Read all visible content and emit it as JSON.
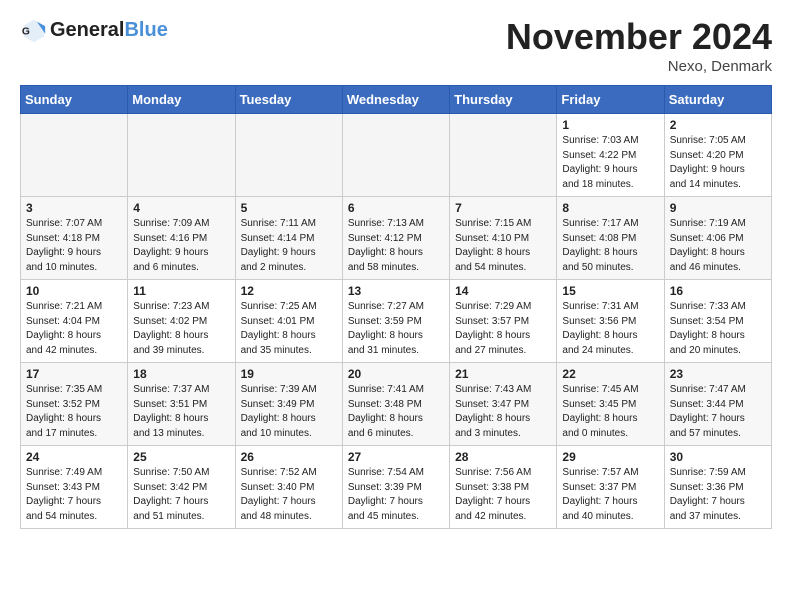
{
  "logo": {
    "line1": "General",
    "line2": "Blue"
  },
  "title": "November 2024",
  "location": "Nexo, Denmark",
  "days_of_week": [
    "Sunday",
    "Monday",
    "Tuesday",
    "Wednesday",
    "Thursday",
    "Friday",
    "Saturday"
  ],
  "weeks": [
    [
      {
        "day": "",
        "info": ""
      },
      {
        "day": "",
        "info": ""
      },
      {
        "day": "",
        "info": ""
      },
      {
        "day": "",
        "info": ""
      },
      {
        "day": "",
        "info": ""
      },
      {
        "day": "1",
        "info": "Sunrise: 7:03 AM\nSunset: 4:22 PM\nDaylight: 9 hours\nand 18 minutes."
      },
      {
        "day": "2",
        "info": "Sunrise: 7:05 AM\nSunset: 4:20 PM\nDaylight: 9 hours\nand 14 minutes."
      }
    ],
    [
      {
        "day": "3",
        "info": "Sunrise: 7:07 AM\nSunset: 4:18 PM\nDaylight: 9 hours\nand 10 minutes."
      },
      {
        "day": "4",
        "info": "Sunrise: 7:09 AM\nSunset: 4:16 PM\nDaylight: 9 hours\nand 6 minutes."
      },
      {
        "day": "5",
        "info": "Sunrise: 7:11 AM\nSunset: 4:14 PM\nDaylight: 9 hours\nand 2 minutes."
      },
      {
        "day": "6",
        "info": "Sunrise: 7:13 AM\nSunset: 4:12 PM\nDaylight: 8 hours\nand 58 minutes."
      },
      {
        "day": "7",
        "info": "Sunrise: 7:15 AM\nSunset: 4:10 PM\nDaylight: 8 hours\nand 54 minutes."
      },
      {
        "day": "8",
        "info": "Sunrise: 7:17 AM\nSunset: 4:08 PM\nDaylight: 8 hours\nand 50 minutes."
      },
      {
        "day": "9",
        "info": "Sunrise: 7:19 AM\nSunset: 4:06 PM\nDaylight: 8 hours\nand 46 minutes."
      }
    ],
    [
      {
        "day": "10",
        "info": "Sunrise: 7:21 AM\nSunset: 4:04 PM\nDaylight: 8 hours\nand 42 minutes."
      },
      {
        "day": "11",
        "info": "Sunrise: 7:23 AM\nSunset: 4:02 PM\nDaylight: 8 hours\nand 39 minutes."
      },
      {
        "day": "12",
        "info": "Sunrise: 7:25 AM\nSunset: 4:01 PM\nDaylight: 8 hours\nand 35 minutes."
      },
      {
        "day": "13",
        "info": "Sunrise: 7:27 AM\nSunset: 3:59 PM\nDaylight: 8 hours\nand 31 minutes."
      },
      {
        "day": "14",
        "info": "Sunrise: 7:29 AM\nSunset: 3:57 PM\nDaylight: 8 hours\nand 27 minutes."
      },
      {
        "day": "15",
        "info": "Sunrise: 7:31 AM\nSunset: 3:56 PM\nDaylight: 8 hours\nand 24 minutes."
      },
      {
        "day": "16",
        "info": "Sunrise: 7:33 AM\nSunset: 3:54 PM\nDaylight: 8 hours\nand 20 minutes."
      }
    ],
    [
      {
        "day": "17",
        "info": "Sunrise: 7:35 AM\nSunset: 3:52 PM\nDaylight: 8 hours\nand 17 minutes."
      },
      {
        "day": "18",
        "info": "Sunrise: 7:37 AM\nSunset: 3:51 PM\nDaylight: 8 hours\nand 13 minutes."
      },
      {
        "day": "19",
        "info": "Sunrise: 7:39 AM\nSunset: 3:49 PM\nDaylight: 8 hours\nand 10 minutes."
      },
      {
        "day": "20",
        "info": "Sunrise: 7:41 AM\nSunset: 3:48 PM\nDaylight: 8 hours\nand 6 minutes."
      },
      {
        "day": "21",
        "info": "Sunrise: 7:43 AM\nSunset: 3:47 PM\nDaylight: 8 hours\nand 3 minutes."
      },
      {
        "day": "22",
        "info": "Sunrise: 7:45 AM\nSunset: 3:45 PM\nDaylight: 8 hours\nand 0 minutes."
      },
      {
        "day": "23",
        "info": "Sunrise: 7:47 AM\nSunset: 3:44 PM\nDaylight: 7 hours\nand 57 minutes."
      }
    ],
    [
      {
        "day": "24",
        "info": "Sunrise: 7:49 AM\nSunset: 3:43 PM\nDaylight: 7 hours\nand 54 minutes."
      },
      {
        "day": "25",
        "info": "Sunrise: 7:50 AM\nSunset: 3:42 PM\nDaylight: 7 hours\nand 51 minutes."
      },
      {
        "day": "26",
        "info": "Sunrise: 7:52 AM\nSunset: 3:40 PM\nDaylight: 7 hours\nand 48 minutes."
      },
      {
        "day": "27",
        "info": "Sunrise: 7:54 AM\nSunset: 3:39 PM\nDaylight: 7 hours\nand 45 minutes."
      },
      {
        "day": "28",
        "info": "Sunrise: 7:56 AM\nSunset: 3:38 PM\nDaylight: 7 hours\nand 42 minutes."
      },
      {
        "day": "29",
        "info": "Sunrise: 7:57 AM\nSunset: 3:37 PM\nDaylight: 7 hours\nand 40 minutes."
      },
      {
        "day": "30",
        "info": "Sunrise: 7:59 AM\nSunset: 3:36 PM\nDaylight: 7 hours\nand 37 minutes."
      }
    ]
  ]
}
